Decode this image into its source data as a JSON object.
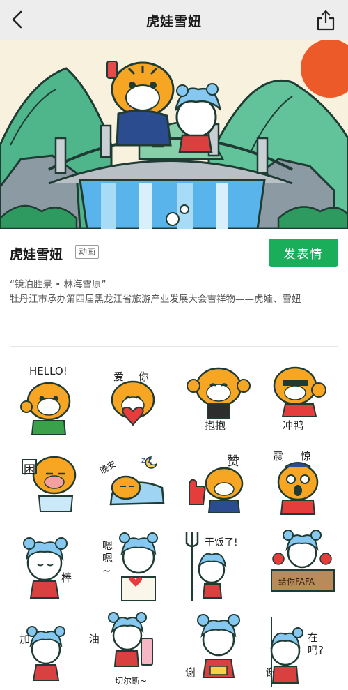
{
  "header": {
    "title": "虎娃雪妞",
    "back_icon": "chevron-left-icon",
    "share_icon": "share-icon"
  },
  "pack": {
    "name": "虎娃雪妞",
    "tag": "动画",
    "send_label": "发表情",
    "send_color": "#1aad5a",
    "description_line1": "“镜泊胜景 • 林海雪原”",
    "description_line2": "牡丹江市承办第四届黑龙江省旅游产业发展大会吉祥物——虎娃、雪妞"
  },
  "stickers": [
    {
      "caption": "HELLO!"
    },
    {
      "caption": "爱 你"
    },
    {
      "caption": "抱抱"
    },
    {
      "caption": "冲鸭"
    },
    {
      "caption": "困"
    },
    {
      "caption": "晚安"
    },
    {
      "caption": "赞"
    },
    {
      "caption": "震 惊"
    },
    {
      "caption": "棒"
    },
    {
      "caption": "嗯嗯~"
    },
    {
      "caption": "干饭了!"
    },
    {
      "caption": "给你FAFA"
    },
    {
      "caption": "加 油"
    },
    {
      "caption": "切尔斯~"
    },
    {
      "caption": "谢 谢"
    },
    {
      "caption": "在吗?"
    }
  ]
}
